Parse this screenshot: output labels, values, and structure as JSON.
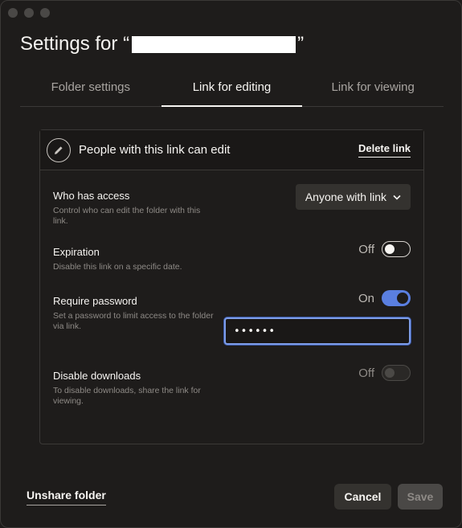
{
  "dialog": {
    "title_prefix": "Settings for “",
    "title_suffix": "”"
  },
  "tabs": [
    {
      "label": "Folder settings",
      "active": false
    },
    {
      "label": "Link for editing",
      "active": true
    },
    {
      "label": "Link for viewing",
      "active": false
    }
  ],
  "link_card": {
    "header_label": "People with this link can edit",
    "delete_label": "Delete link",
    "header_icon": "pencil-icon"
  },
  "settings": {
    "who_has_access": {
      "title": "Who has access",
      "description": "Control who can edit the folder with this link.",
      "value": "Anyone with link",
      "icon": "chevron-down-icon"
    },
    "expiration": {
      "title": "Expiration",
      "description": "Disable this link on a specific date.",
      "state": "Off"
    },
    "require_password": {
      "title": "Require password",
      "description": "Set a password to limit access to the folder via link.",
      "state": "On",
      "password_value": "••••••"
    },
    "disable_downloads": {
      "title": "Disable downloads",
      "description": "To disable downloads, share the link for viewing.",
      "state": "Off"
    }
  },
  "footer": {
    "unshare_label": "Unshare folder",
    "cancel_label": "Cancel",
    "save_label": "Save"
  },
  "colors": {
    "background": "#1e1c1b",
    "accent": "#5a7fe0",
    "text": "#f7f5f2"
  }
}
